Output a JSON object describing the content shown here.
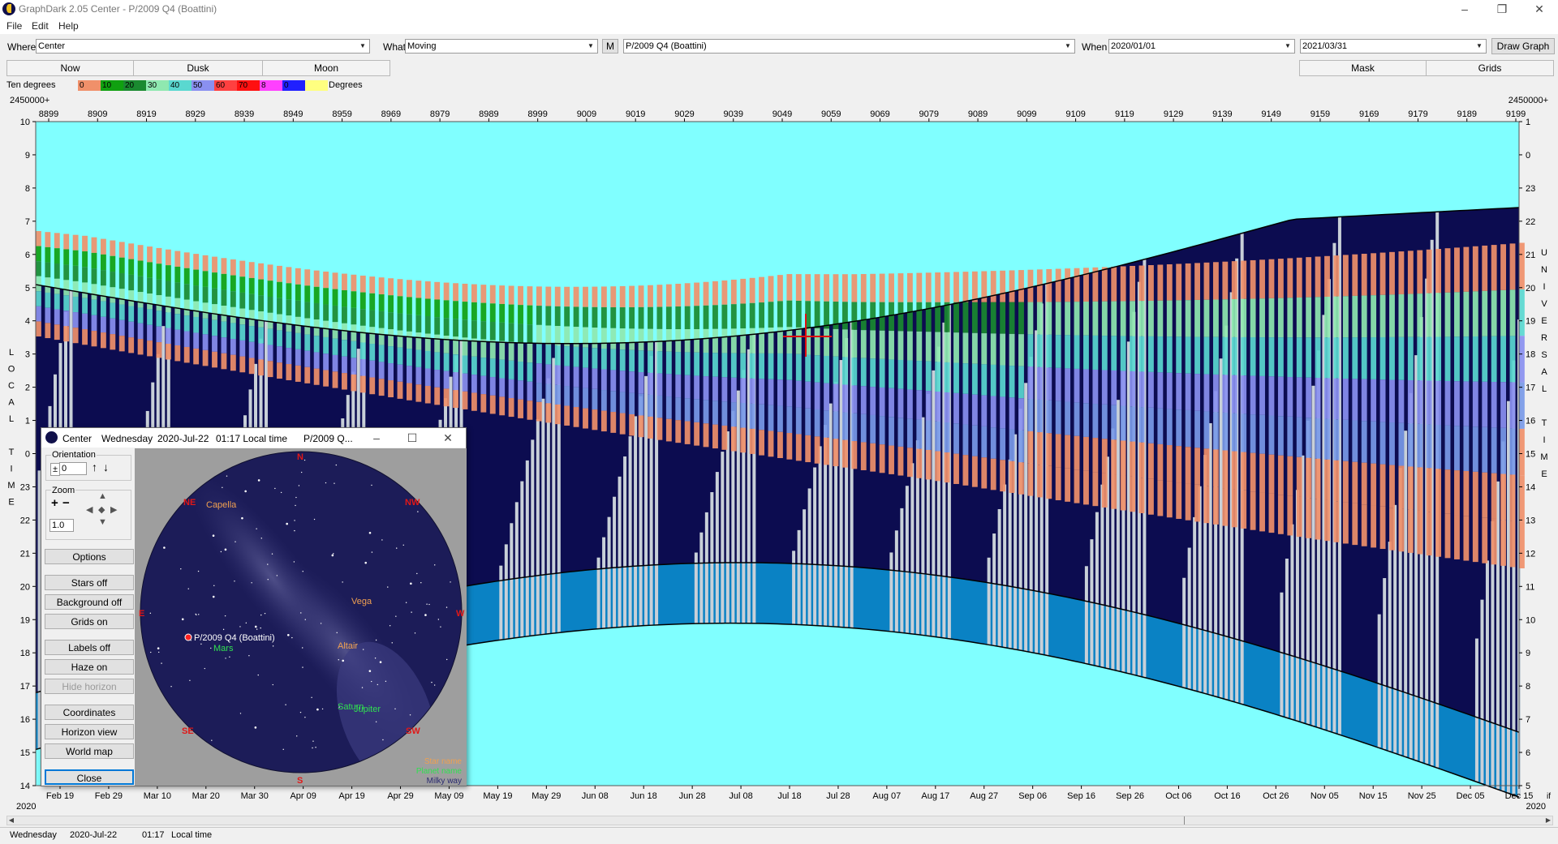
{
  "window": {
    "title": "GraphDark 2.05  Center  -  P/2009 Q4 (Boattini)",
    "minimize": "–",
    "maximize": "❐",
    "close": "✕"
  },
  "menu": [
    "File",
    "Edit",
    "Help"
  ],
  "toolbar": {
    "where_label": "Where",
    "where_value": "Center",
    "what_label": "What",
    "what_value": "Moving",
    "m_button": "M",
    "object_value": "P/2009 Q4 (Boattini)",
    "when_label": "When",
    "start_date": "2020/01/01",
    "end_date": "2021/03/31",
    "draw_graph": "Draw Graph"
  },
  "tabs": {
    "now": "Now",
    "dusk": "Dusk",
    "moon": "Moon",
    "mask": "Mask",
    "grids": "Grids"
  },
  "legend": {
    "label": "Ten degrees",
    "unit": "Degrees",
    "swatches": [
      {
        "text": "0",
        "color": "#f0906a"
      },
      {
        "text": "10",
        "color": "#10a010"
      },
      {
        "text": "20",
        "color": "#1a8a30"
      },
      {
        "text": "30",
        "color": "#8fe8b0"
      },
      {
        "text": "40",
        "color": "#5ad8d0"
      },
      {
        "text": "50",
        "color": "#8a90f0"
      },
      {
        "text": "60",
        "color": "#ff4040"
      },
      {
        "text": "70",
        "color": "#ff1010"
      },
      {
        "text": "8",
        "color": "#ff40ff"
      },
      {
        "text": "0",
        "color": "#2020ff"
      },
      {
        "text": "",
        "color": "#ffff80"
      }
    ]
  },
  "chart_data": {
    "type": "area",
    "top_axis_prefix_left": "2450000+",
    "top_axis_prefix_right": "2450000+",
    "jd_ticks": [
      "8899",
      "8909",
      "8919",
      "8929",
      "8939",
      "8949",
      "8959",
      "8969",
      "8979",
      "8989",
      "8999",
      "9009",
      "9019",
      "9029",
      "9039",
      "9049",
      "9059",
      "9069",
      "9079",
      "9089",
      "9099",
      "9109",
      "9119",
      "9129",
      "9139",
      "9149",
      "9159",
      "9169",
      "9179",
      "9189",
      "9199"
    ],
    "date_ticks": [
      "Feb 19",
      "Feb 29",
      "Mar 10",
      "Mar 20",
      "Mar 30",
      "Apr 09",
      "Apr 19",
      "Apr 29",
      "May 09",
      "May 19",
      "May 29",
      "Jun 08",
      "Jun 18",
      "Jun 28",
      "Jul 08",
      "Jul 18",
      "Jul 28",
      "Aug 07",
      "Aug 17",
      "Aug 27",
      "Sep 06",
      "Sep 16",
      "Sep 26",
      "Oct 06",
      "Oct 16",
      "Oct 26",
      "Nov 05",
      "Nov 15",
      "Nov 25",
      "Dec 05",
      "Dec 15"
    ],
    "year_left": "2020",
    "year_right": "2020",
    "left_axis_title": "LOCAL TIME",
    "left_axis_ticks": [
      "10",
      "9",
      "8",
      "7",
      "6",
      "5",
      "4",
      "3",
      "2",
      "1",
      "0",
      "23",
      "22",
      "21",
      "20",
      "19",
      "18",
      "17",
      "16",
      "15",
      "14"
    ],
    "right_axis_title": "UNIVERSAL TIME",
    "right_axis_ticks": [
      "1",
      "0",
      "23",
      "22",
      "21",
      "20",
      "19",
      "18",
      "17",
      "16",
      "15",
      "14",
      "13",
      "12",
      "11",
      "10",
      "9",
      "8",
      "7",
      "6",
      "5"
    ],
    "right_edge_label": "if",
    "colors": {
      "day": "#80ffff",
      "night": "#0c0c50",
      "twilight": "#0a82c4",
      "moon": "#c8d0d8"
    }
  },
  "sky_dialog": {
    "title_name": "Center",
    "title_day": "Wednesday",
    "title_date": "2020-Jul-22",
    "title_time": "01:17 Local time",
    "title_object": "P/2009 Q...",
    "orientation_label": "Orientation",
    "orientation_value": "0",
    "zoom_label": "Zoom",
    "zoom_value": "1.0",
    "buttons": {
      "options": "Options",
      "stars": "Stars off",
      "background": "Background off",
      "grids": "Grids on",
      "labels": "Labels off",
      "haze": "Haze on",
      "horizon": "Hide horizon",
      "coordinates": "Coordinates",
      "horizon_view": "Horizon view",
      "world_map": "World map",
      "close": "Close"
    },
    "compass": {
      "n": "N",
      "ne": "NE",
      "nw": "NW",
      "e": "E",
      "w": "W",
      "se": "SE",
      "sw": "SW",
      "s": "S"
    },
    "labels": {
      "capella": "Capella",
      "vega": "Vega",
      "altair": "Altair",
      "comet": "P/2009 Q4 (Boattini)",
      "mars": "Mars",
      "saturn": "Saturn",
      "jupiter": "Jupiter"
    },
    "key": {
      "star": "Star name",
      "planet": "Planet name",
      "milky": "Milky way"
    }
  },
  "status": {
    "day": "Wednesday",
    "date": "2020-Jul-22",
    "time": "01:17",
    "mode": "Local time"
  }
}
